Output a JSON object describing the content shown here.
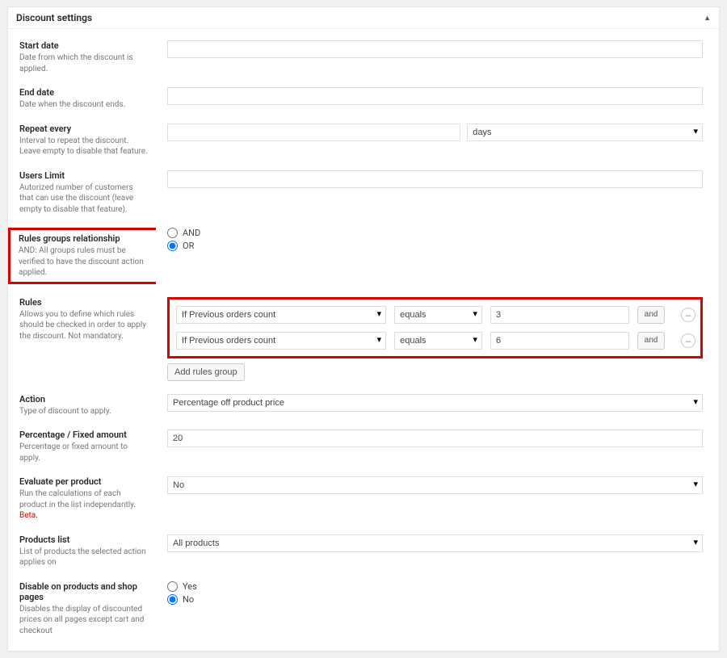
{
  "panel": {
    "title": "Discount settings"
  },
  "fields": {
    "start_date": {
      "label": "Start date",
      "desc": "Date from which the discount is applied.",
      "value": ""
    },
    "end_date": {
      "label": "End date",
      "desc": "Date when the discount ends.",
      "value": ""
    },
    "repeat": {
      "label": "Repeat every",
      "desc": "Interval to repeat the discount. Leave empty to disable that feature.",
      "value": "",
      "unit_selected": "days"
    },
    "users_limit": {
      "label": "Users Limit",
      "desc": "Autorized number of customers that can use the discount (leave empty to disable that feature).",
      "value": ""
    },
    "relationship": {
      "label": "Rules groups relationship",
      "desc": "AND: All groups rules must be verified to have the discount action applied.",
      "and": "AND",
      "or": "OR"
    },
    "rules": {
      "label": "Rules",
      "desc": "Allows you to define which rules should be checked in order to apply the discount. Not mandatory.",
      "add_group": "Add rules group"
    },
    "action": {
      "label": "Action",
      "desc": "Type of discount to apply.",
      "selected": "Percentage off product price"
    },
    "amount": {
      "label": "Percentage / Fixed amount",
      "desc": "Percentage or fixed amount to apply.",
      "value": "20"
    },
    "evaluate": {
      "label": "Evaluate per product",
      "desc": "Run the calculations of each product in the list independantly.",
      "beta": "Beta.",
      "selected": "No"
    },
    "products_list": {
      "label": "Products list",
      "desc": "List of products the selected action applies on",
      "selected": "All products"
    },
    "disable_display": {
      "label": "Disable on products and shop pages",
      "desc": "Disables the display of discounted prices on all pages except cart and checkout",
      "yes": "Yes",
      "no": "No"
    }
  },
  "rules_rows": [
    {
      "condition": "If Previous orders count",
      "operator": "equals",
      "value": "3",
      "join": "and",
      "remove": "–"
    },
    {
      "condition": "If Previous orders count",
      "operator": "equals",
      "value": "6",
      "join": "and",
      "remove": "–"
    }
  ]
}
